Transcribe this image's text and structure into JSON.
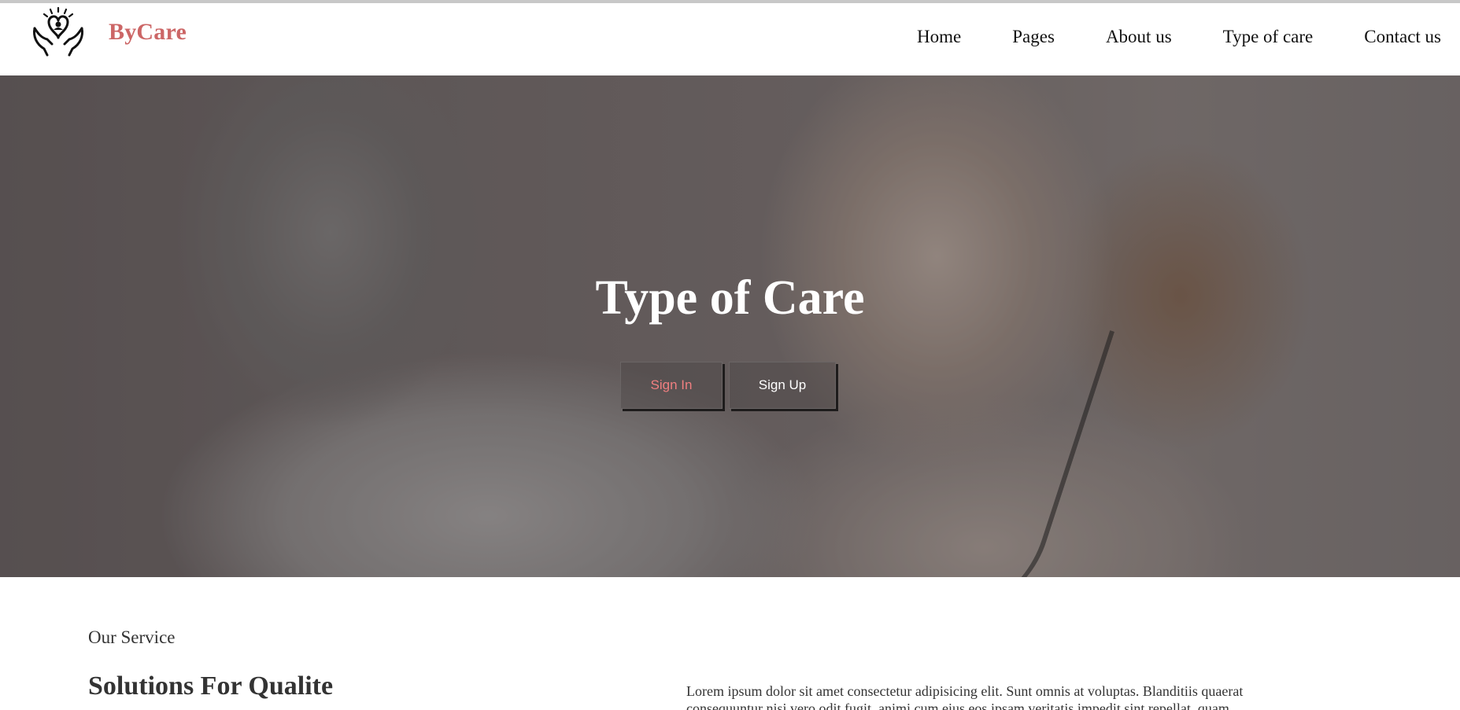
{
  "brand": {
    "name": "ByCare",
    "logo_icon": "care-hands-heart-icon"
  },
  "nav": {
    "items": [
      {
        "label": "Home"
      },
      {
        "label": "Pages"
      },
      {
        "label": "About us"
      },
      {
        "label": "Type of care"
      },
      {
        "label": "Contact us"
      }
    ]
  },
  "hero": {
    "title": "Type of Care",
    "sign_in_label": "Sign In",
    "sign_up_label": "Sign Up"
  },
  "service": {
    "eyebrow": "Our Service",
    "title": "Solutions For Qualite",
    "text": "Lorem ipsum dolor sit amet consectetur adipisicing elit. Sunt omnis at voluptas. Blanditiis quaerat consequuntur nisi vero odit fugit, animi cum eius eos ipsam veritatis impedit sint repellat, quam"
  },
  "colors": {
    "brand_accent": "#cc6666",
    "sign_in_text": "#f07f80",
    "nav_text": "#111111",
    "body_text": "#333333"
  }
}
